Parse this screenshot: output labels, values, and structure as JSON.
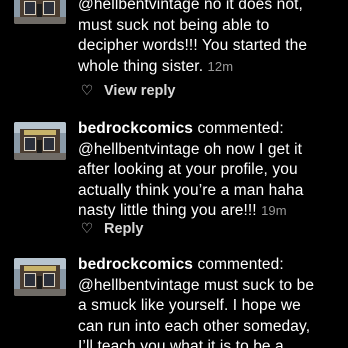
{
  "comments": [
    {
      "lines": [
        "@hellbentvintage no it does not,",
        "must suck not being able to",
        "decipher words!!! You started the",
        "whole thing sister."
      ],
      "time": "12m",
      "action": {
        "label": "View reply",
        "icon": "heart-outline-icon"
      }
    },
    {
      "username": "bedrockcomics",
      "commented": "commented:",
      "lines": [
        "@hellbentvintage oh now I get it",
        "after looking at your profile, you",
        "actually think you’re a man haha",
        "nasty little thing you are!!!"
      ],
      "time": "19m",
      "action": {
        "label": "Reply",
        "icon": "heart-outline-icon"
      }
    },
    {
      "username": "bedrockcomics",
      "commented": "commented:",
      "lines": [
        "@hellbentvintage must suck to be",
        "a smuck like yourself. I hope we",
        "can run into each other someday,",
        "I’ll teach you what it is to be a"
      ]
    }
  ]
}
